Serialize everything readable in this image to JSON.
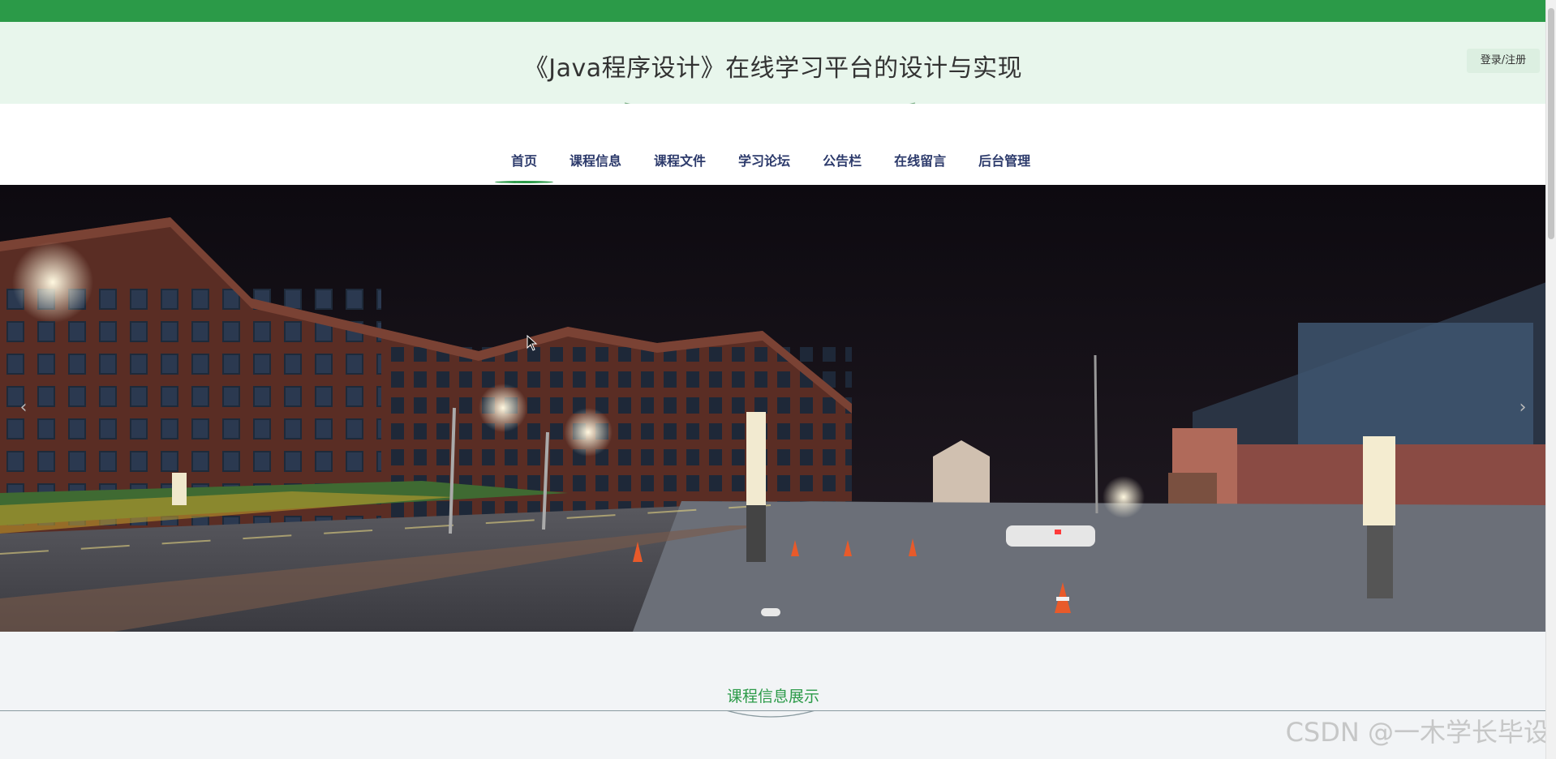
{
  "header": {
    "title": "《Java程序设计》在线学习平台的设计与实现",
    "login_label": "登录/注册"
  },
  "nav": {
    "items": [
      {
        "label": "首页",
        "active": true
      },
      {
        "label": "课程信息"
      },
      {
        "label": "课程文件"
      },
      {
        "label": "学习论坛"
      },
      {
        "label": "公告栏"
      },
      {
        "label": "在线留言"
      },
      {
        "label": "后台管理"
      }
    ]
  },
  "banner": {
    "prev_icon": "‹",
    "next_icon": "›"
  },
  "section": {
    "title": "课程信息展示"
  },
  "watermark": "CSDN @一木学长毕设",
  "colors": {
    "brand_green": "#2b9a48",
    "header_bg": "#e8f6ec",
    "nav_text": "#2c3a6b"
  }
}
